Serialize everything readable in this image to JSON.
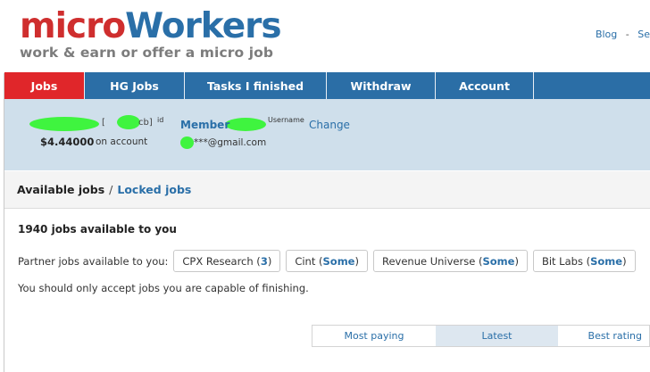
{
  "logo": {
    "micro": "micro",
    "workers": "Workers",
    "tagline": "work & earn or offer a micro job"
  },
  "top_links": {
    "blog": "Blog",
    "separator": "-",
    "next": "Se"
  },
  "nav": [
    {
      "label": "Jobs",
      "active": true
    },
    {
      "label": "HG Jobs",
      "active": false
    },
    {
      "label": "Tasks I finished",
      "active": false
    },
    {
      "label": "Withdraw",
      "active": false
    },
    {
      "label": "Account",
      "active": false
    }
  ],
  "account": {
    "id_prefix": "[",
    "id_suffix": "cb]",
    "id_label": "id",
    "balance": "$4.44000",
    "balance_label": "on account",
    "member_label": "Member",
    "username_label": "Username",
    "change_link": "Change",
    "email": "***@gmail.com"
  },
  "subtabs": {
    "current": "Available jobs",
    "slash": "/",
    "locked": "Locked jobs"
  },
  "jobs": {
    "count_text": "1940 jobs available to you",
    "partner_label": "Partner jobs available to you:",
    "partners": [
      {
        "name": "CPX Research",
        "value": "3"
      },
      {
        "name": "Cint",
        "value": "Some"
      },
      {
        "name": "Revenue Universe",
        "value": "Some"
      },
      {
        "name": "Bit Labs",
        "value": "Some"
      }
    ],
    "notice": "You should only accept jobs you are capable of finishing."
  },
  "sort": [
    {
      "label": "Most paying",
      "active": false
    },
    {
      "label": "Latest",
      "active": true
    },
    {
      "label": "Best rating",
      "active": false
    }
  ],
  "colors": {
    "brand_red": "#e0262a",
    "brand_blue": "#2b6ea6",
    "panel": "#cfdfeb",
    "redaction": "#3ff43f"
  }
}
